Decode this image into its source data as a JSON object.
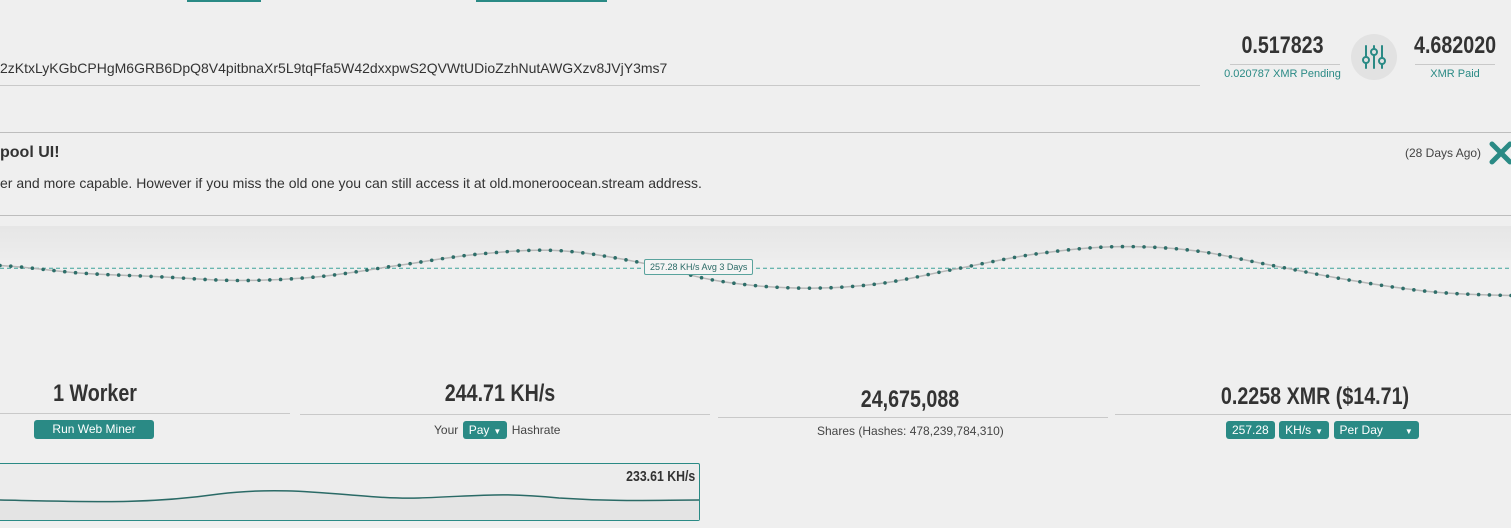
{
  "header": {
    "address": "2zKtxLyKGbCPHgM6GRB6DpQ8V4pitbnaXr5L9tqFfa5W42dxxpwS2QVWtUDioZzhNutAWGXzv8JVjY3ms7",
    "balance_value": "0.517823",
    "pending_label": "0.020787 XMR Pending",
    "paid_value": "4.682020",
    "paid_label": "XMR Paid",
    "settings_icon": "sliders-icon"
  },
  "notice": {
    "title": "pool UI!",
    "text": "er and more capable. However if you miss the old one you can still access it at old.moneroocean.stream address.",
    "age": "(28 Days Ago)",
    "close_icon": "close-icon"
  },
  "chart_data": {
    "type": "line",
    "avg_label": "257.28 KH/s Avg 3 Days",
    "series": [
      {
        "values": [
          258,
          256,
          255,
          254,
          255,
          258,
          261,
          262,
          259,
          254,
          252,
          253,
          257,
          261,
          263,
          262,
          258,
          254,
          251,
          250
        ]
      }
    ],
    "avg_value": 257.28,
    "colors": {
      "line": "#2e6e69",
      "avg": "#3fa39a"
    }
  },
  "stats": {
    "workers": "1 Worker",
    "web_miner_button": "Run Web Miner",
    "hashrate": "244.71 KH/s",
    "hashrate_prefix": "Your",
    "hashrate_select": "Pay",
    "hashrate_suffix": "Hashrate",
    "shares": "24,675,088",
    "shares_label": "Shares (Hashes: 478,239,784,310)",
    "earnings": "0.2258 XMR ($14.71)",
    "calc_value": "257.28",
    "calc_unit": "KH/s",
    "calc_period": "Per Day"
  },
  "worker_panel": {
    "rate": "233.61 KH/s"
  },
  "colors": {
    "accent": "#2a8a85",
    "background": "#efefef"
  }
}
